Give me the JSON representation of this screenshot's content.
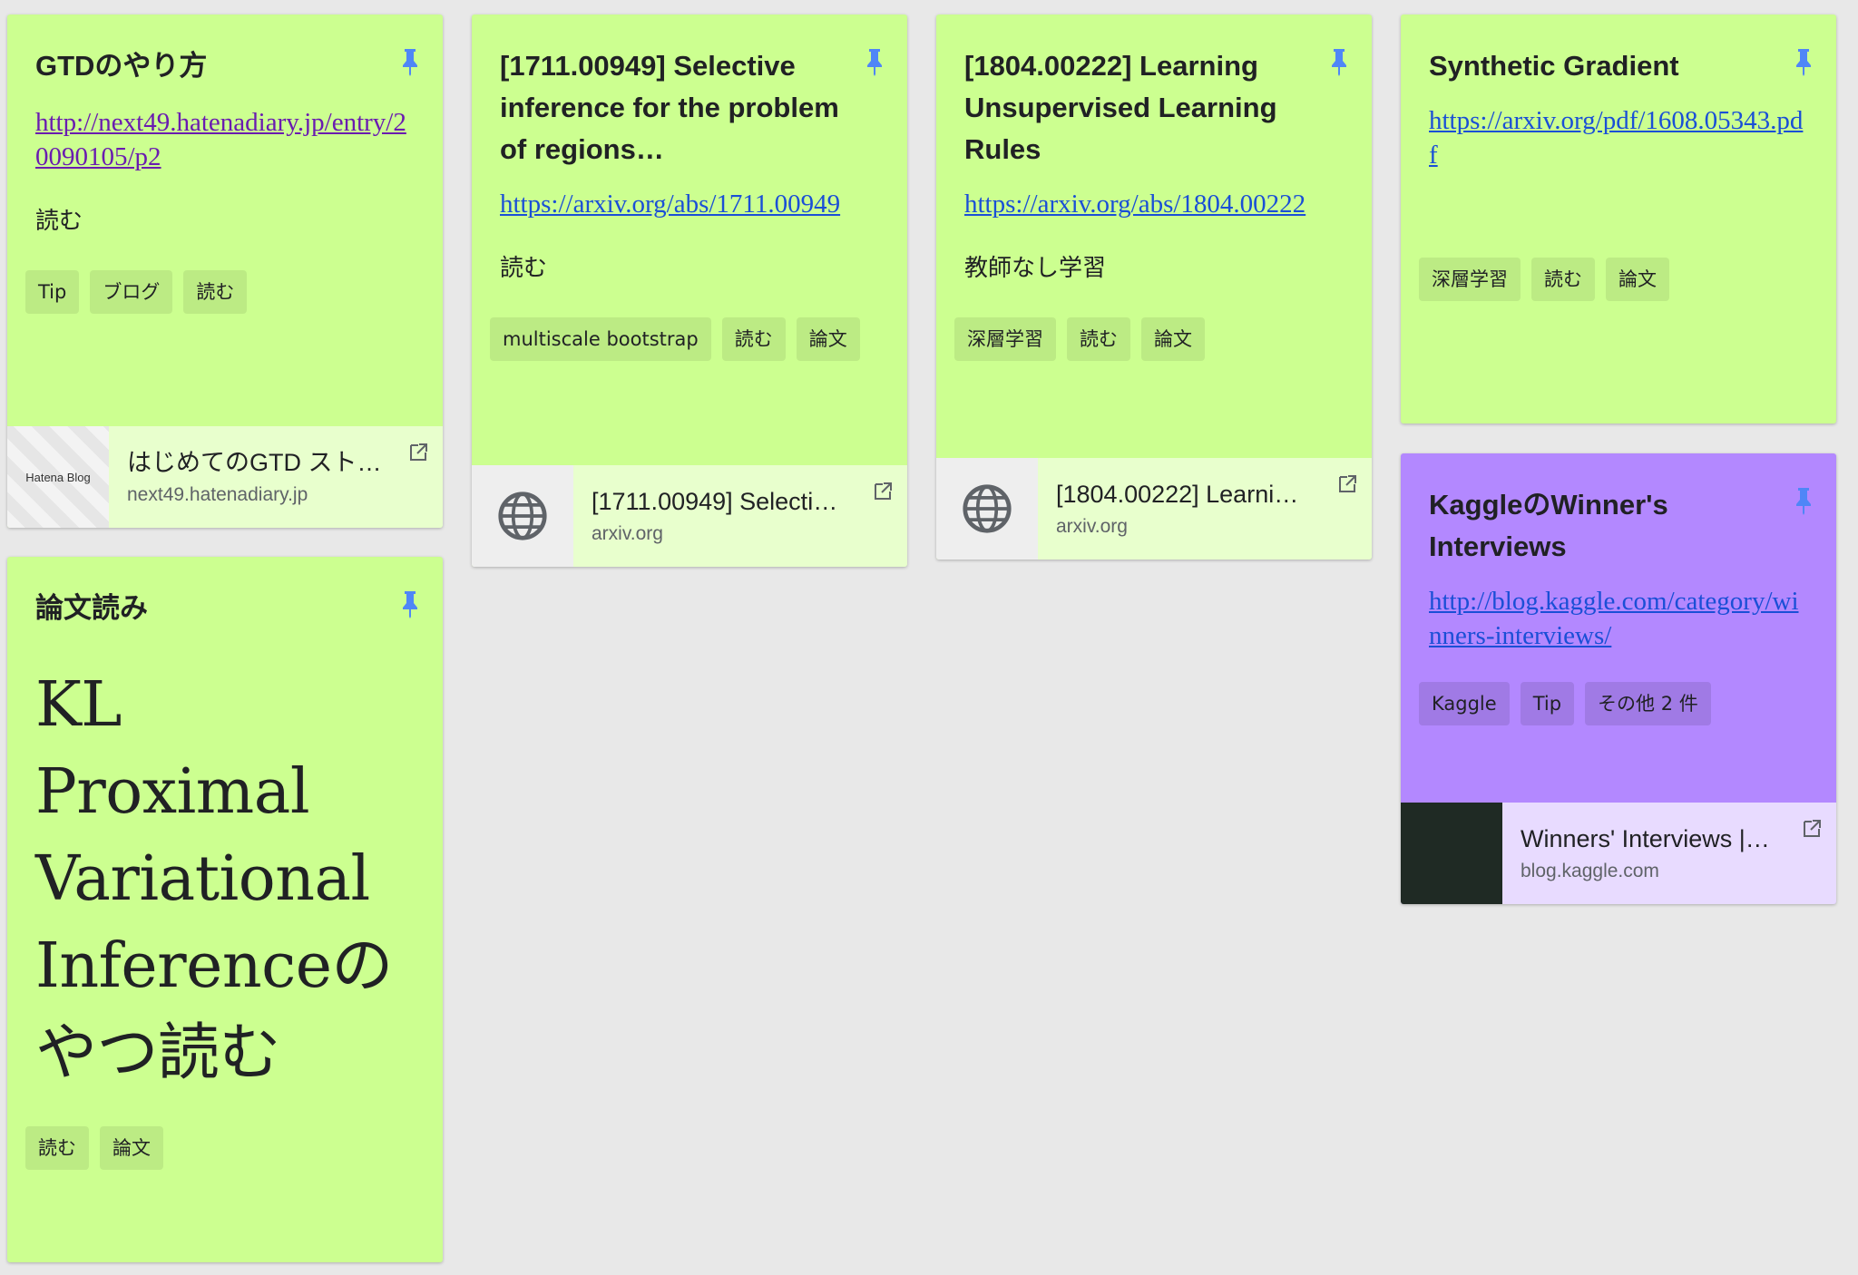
{
  "notes": [
    {
      "title": "GTDのやり方",
      "link": "http://next49.hatenadiary.jp/entry/20090105/p2",
      "body": "読む",
      "labels": [
        "Tip",
        "ブログ",
        "読む"
      ],
      "preview": {
        "thumb_text": "Hatena Blog",
        "title": "はじめてのGTD スト…",
        "domain": "next49.hatenadiary.jp"
      }
    },
    {
      "title": "論文読み",
      "body": "KL Proximal Variational Inferenceのやつ読む",
      "labels": [
        "読む",
        "論文"
      ]
    },
    {
      "title": "[1711.00949] Selective inference for the problem of regions…",
      "link": "https://arxiv.org/abs/1711.00949",
      "body": "読む",
      "labels": [
        "multiscale bootstrap",
        "読む",
        "論文"
      ],
      "preview": {
        "title": "[1711.00949] Selective …",
        "domain": "arxiv.org"
      }
    },
    {
      "title": "[1804.00222] Learning Unsupervised Learning Rules",
      "link": "https://arxiv.org/abs/1804.00222",
      "body": "教師なし学習",
      "labels": [
        "深層学習",
        "読む",
        "論文"
      ],
      "preview": {
        "title": "[1804.00222] Learning …",
        "domain": "arxiv.org"
      }
    },
    {
      "title": "Synthetic Gradient",
      "link": "https://arxiv.org/pdf/1608.05343.pdf",
      "labels": [
        "深層学習",
        "読む",
        "論文"
      ]
    },
    {
      "title": "KaggleのWinner's Interviews",
      "link": "http://blog.kaggle.com/category/winners-interviews/",
      "labels": [
        "Kaggle",
        "Tip",
        "その他 2 件"
      ],
      "preview": {
        "title": "Winners' Interviews | N…",
        "domain": "blog.kaggle.com"
      }
    }
  ],
  "colors": {
    "background": "#e8e8e8",
    "note_green": "#ccff90",
    "note_purple": "#b388ff",
    "pin": "#4f86f7",
    "link": "#1a4fd6",
    "link_visited": "#6a1bb0"
  },
  "icons": {
    "pin": "pin-icon",
    "globe": "globe-icon",
    "open_external": "open-in-new-icon"
  }
}
